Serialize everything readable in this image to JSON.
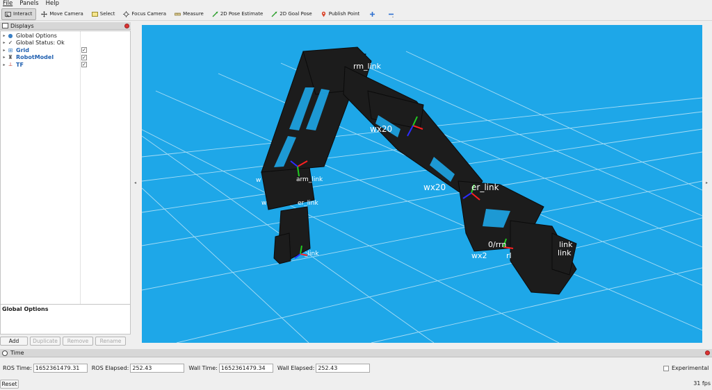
{
  "menu": {
    "file": "File",
    "panels": "Panels",
    "help": "Help"
  },
  "toolbar": {
    "interact": "Interact",
    "move_camera": "Move Camera",
    "select": "Select",
    "focus_camera": "Focus Camera",
    "measure": "Measure",
    "pose_estimate": "2D Pose Estimate",
    "goal_pose": "2D Goal Pose",
    "publish_point": "Publish Point"
  },
  "displays": {
    "title": "Displays",
    "items": [
      {
        "label": "Global Options",
        "icon": "globe-icon"
      },
      {
        "label": "Global Status: Ok",
        "icon": "check-icon"
      },
      {
        "label": "Grid",
        "icon": "grid-icon",
        "checked": true
      },
      {
        "label": "RobotModel",
        "icon": "robot-icon",
        "checked": true
      },
      {
        "label": "TF",
        "icon": "axes-icon",
        "checked": true
      }
    ],
    "properties_title": "Global Options",
    "buttons": {
      "add": "Add",
      "duplicate": "Duplicate",
      "remove": "Remove",
      "rename": "Rename"
    }
  },
  "viewport": {
    "background": "#1ea7e8",
    "robot_color": "#1c1c1c",
    "labels": {
      "a": "rm_link",
      "b": "wx20",
      "c": "wx20",
      "d": "er_link",
      "e": "w",
      "f": "arm_link",
      "g": "w",
      "h": "er_link",
      "i": "_link",
      "j": "0/rrn",
      "k": "link",
      "l": "wx2",
      "m": "rl",
      "n": "link"
    }
  },
  "time": {
    "title": "Time",
    "ros_time_label": "ROS Time:",
    "ros_time": "1652361479.31",
    "ros_elapsed_label": "ROS Elapsed:",
    "ros_elapsed": "252.43",
    "wall_time_label": "Wall Time:",
    "wall_time": "1652361479.34",
    "wall_elapsed_label": "Wall Elapsed:",
    "wall_elapsed": "252.43",
    "experimental_label": "Experimental",
    "reset_label": "Reset",
    "fps": "31 fps"
  }
}
